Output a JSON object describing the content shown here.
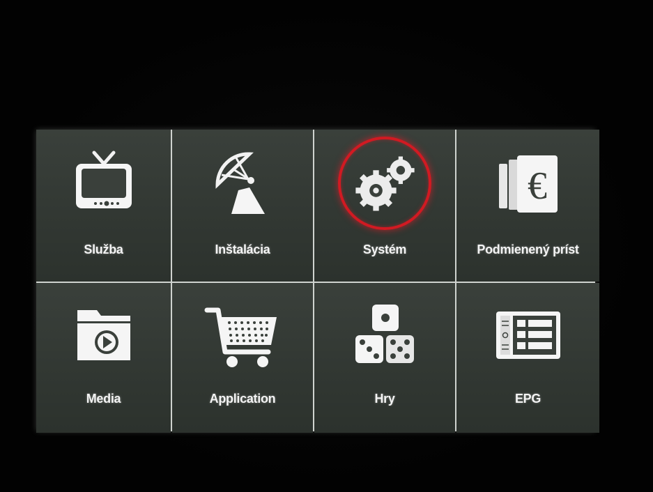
{
  "menu": {
    "selected_index": 2,
    "accent_color": "#d11a22",
    "items": [
      {
        "label": "Služba",
        "icon": "tv-icon"
      },
      {
        "label": "Inštalácia",
        "icon": "satellite-dish-icon"
      },
      {
        "label": "Systém",
        "icon": "gears-icon"
      },
      {
        "label": "Podmienený príst",
        "icon": "euro-cards-icon"
      },
      {
        "label": "Media",
        "icon": "media-folder-icon"
      },
      {
        "label": "Application",
        "icon": "shopping-cart-icon"
      },
      {
        "label": "Hry",
        "icon": "dice-icon"
      },
      {
        "label": "EPG",
        "icon": "epg-guide-icon"
      }
    ]
  }
}
